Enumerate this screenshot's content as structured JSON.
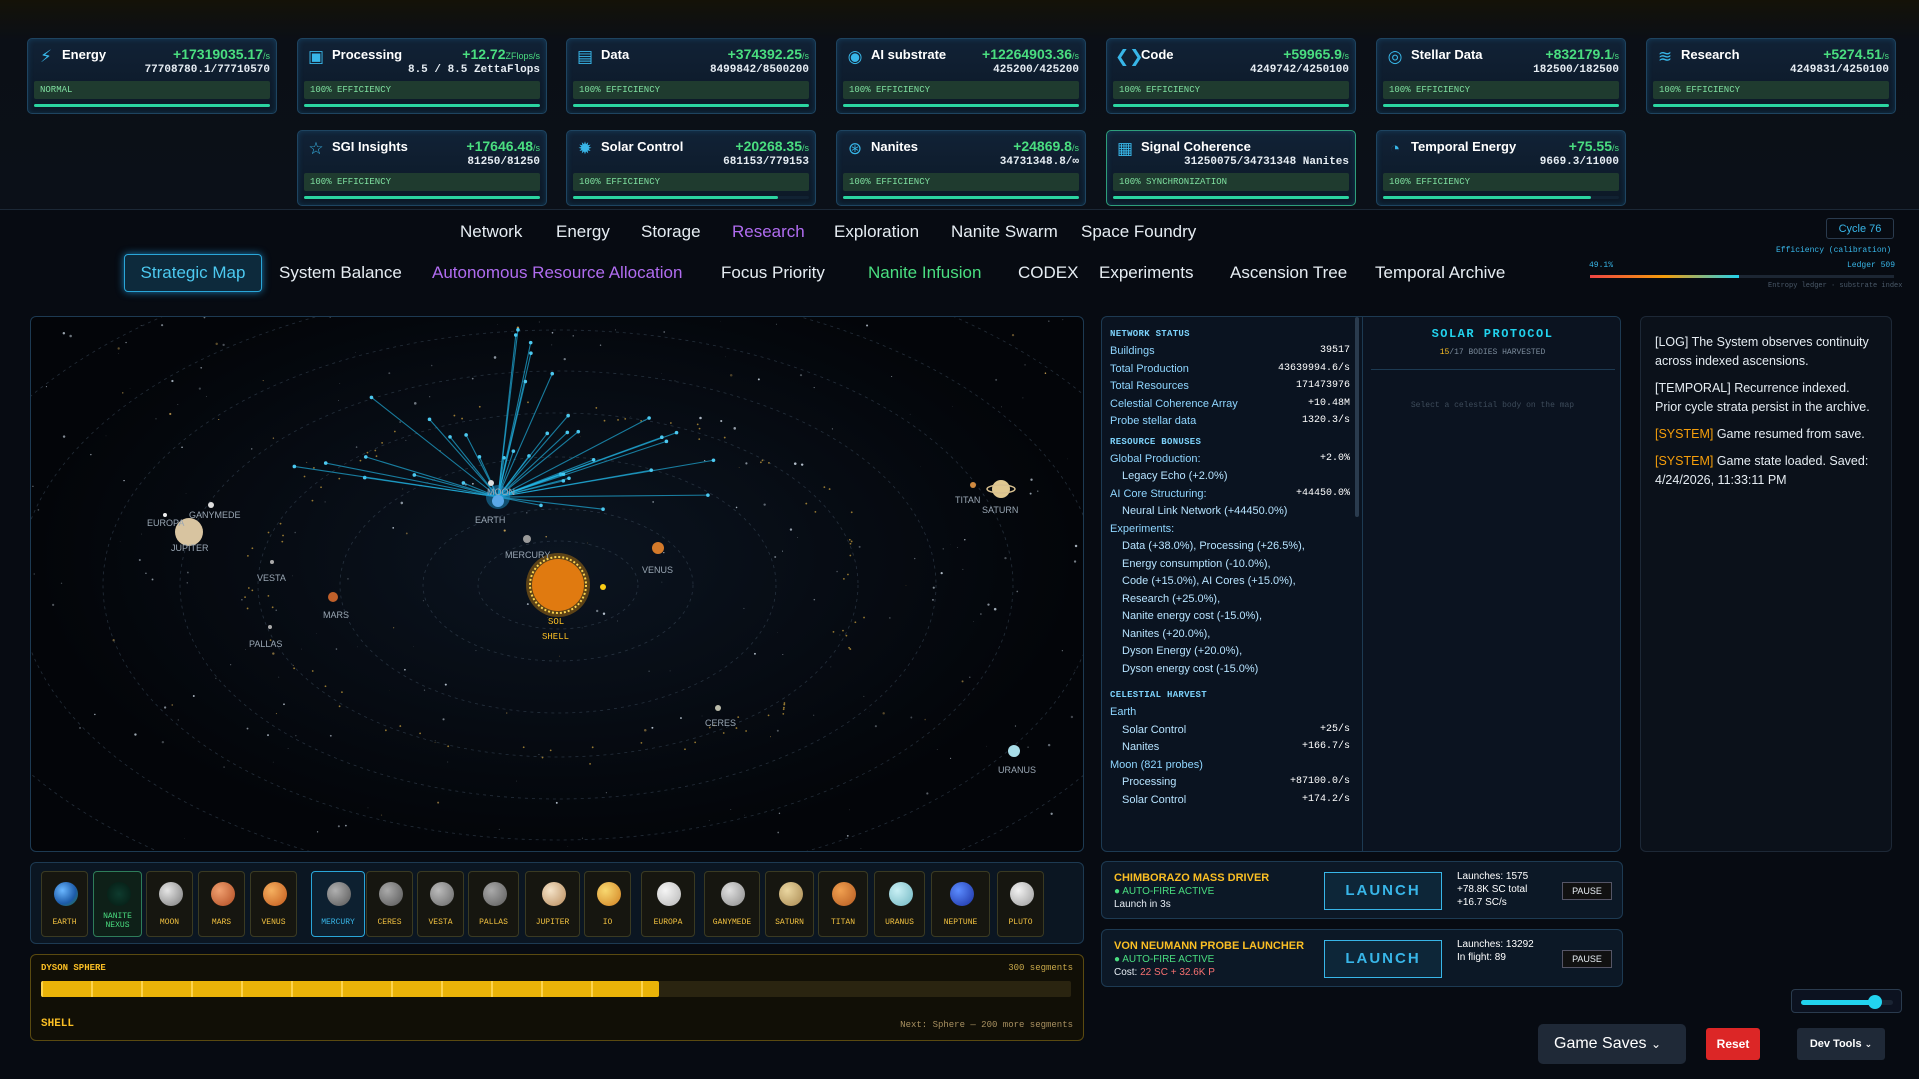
{
  "resources": [
    {
      "name": "Energy",
      "rate": "+17319035.17",
      "unit": "/s",
      "amount": "77708780.1/77710570",
      "status": "NORMAL",
      "icon": "lightning-icon",
      "bar": 1.0
    },
    {
      "name": "Processing",
      "rate": "+12.72",
      "unit": "ZFlops/s",
      "amount": "8.5 / 8.5 ZettaFlops",
      "status": "100% EFFICIENCY",
      "icon": "chip-icon",
      "bar": 1.0
    },
    {
      "name": "Data",
      "rate": "+374392.25",
      "unit": "/s",
      "amount": "8499842/8500200",
      "status": "100% EFFICIENCY",
      "icon": "database-icon",
      "bar": 1.0
    },
    {
      "name": "AI substrate",
      "rate": "+12264903.36",
      "unit": "/s",
      "amount": "425200/425200",
      "status": "100% EFFICIENCY",
      "icon": "brain-icon",
      "bar": 1.0
    },
    {
      "name": "Code",
      "rate": "+59965.9",
      "unit": "/s",
      "amount": "4249742/4250100",
      "status": "100% EFFICIENCY",
      "icon": "code-icon",
      "bar": 1.0
    },
    {
      "name": "Stellar Data",
      "rate": "+832179.1",
      "unit": "/s",
      "amount": "182500/182500",
      "status": "100% EFFICIENCY",
      "icon": "target-icon",
      "bar": 1.0
    },
    {
      "name": "Research",
      "rate": "+5274.51",
      "unit": "/s",
      "amount": "4249831/4250100",
      "status": "100% EFFICIENCY",
      "icon": "layers-icon",
      "bar": 1.0
    },
    {
      "name": "SGI Insights",
      "rate": "+17646.48",
      "unit": "/s",
      "amount": "81250/81250",
      "status": "100% EFFICIENCY",
      "icon": "star-icon",
      "bar": 1.0
    },
    {
      "name": "Solar Control",
      "rate": "+20268.35",
      "unit": "/s",
      "amount": "681153/779153",
      "status": "100% EFFICIENCY",
      "icon": "sun-icon",
      "bar": 0.87
    },
    {
      "name": "Nanites",
      "rate": "+24869.8",
      "unit": "/s",
      "amount": "34731348.8/∞",
      "status": "100% EFFICIENCY",
      "icon": "nanite-icon",
      "bar": 1.0
    },
    {
      "name": "Signal Coherence",
      "rate": "",
      "unit": "",
      "amount": "31250075/34731348 Nanites",
      "status": "100% SYNCHRONIZATION",
      "icon": "signal-icon",
      "bar": 1.0
    },
    {
      "name": "Temporal Energy",
      "rate": "+75.55",
      "unit": "/s",
      "amount": "9669.3/11000",
      "status": "100% EFFICIENCY",
      "icon": "clock-icon",
      "bar": 0.88
    }
  ],
  "nav_primary": [
    "Network",
    "Energy",
    "Storage",
    "Research",
    "Exploration",
    "Nanite Swarm",
    "Space Foundry"
  ],
  "nav_secondary": [
    "Strategic Map",
    "System Balance",
    "Autonomous Resource Allocation",
    "Focus Priority",
    "Nanite Infusion",
    "CODEX",
    "Experiments",
    "Ascension Tree",
    "Temporal Archive"
  ],
  "cycle": {
    "label": "Cycle 76",
    "efficiency_label": "Efficiency (calibration)",
    "pct": "49.1%",
    "ledger": "Ledger 509",
    "entropy": "Entropy ledger · substrate index",
    "fraction": 0.491
  },
  "map_labels": {
    "earth": "EARTH",
    "moon": "MOON",
    "mercury": "MERCURY",
    "venus": "VENUS",
    "mars": "MARS",
    "jupiter": "JUPITER",
    "europa": "EUROPA",
    "ganymede": "GANYMEDE",
    "vesta": "VESTA",
    "pallas": "PALLAS",
    "ceres": "CERES",
    "saturn": "SATURN",
    "titan": "TITAN",
    "uranus": "URANUS",
    "sol": "SOL",
    "shell": "SHELL"
  },
  "bodies": [
    "EARTH",
    "NANITE NEXUS",
    "MOON",
    "MARS",
    "VENUS",
    "MERCURY",
    "CERES",
    "VESTA",
    "PALLAS",
    "JUPITER",
    "IO",
    "EUROPA",
    "GANYMEDE",
    "SATURN",
    "TITAN",
    "URANUS",
    "NEPTUNE",
    "PLUTO"
  ],
  "dyson": {
    "title": "DYSON SPHERE",
    "segments": "300 segments",
    "stage": "SHELL",
    "next": "Next: Sphere — 200 more segments",
    "fraction": 0.6
  },
  "network": {
    "title": "NETWORK STATUS",
    "rows": [
      [
        "Buildings",
        "39517"
      ],
      [
        "Total Production",
        "43639994.6/s"
      ],
      [
        "Total Resources",
        "171473976"
      ],
      [
        "Celestial Coherence Array",
        "+10.48M"
      ],
      [
        "Probe stellar data",
        "1320.3/s"
      ]
    ],
    "bonus_title": "RESOURCE BONUSES",
    "bonus_rows": [
      [
        "Global Production:",
        "+2.0%",
        false
      ],
      [
        "Legacy Echo (+2.0%)",
        "",
        true
      ],
      [
        "AI Core Structuring:",
        "+44450.0%",
        false
      ],
      [
        "Neural Link Network (+44450.0%)",
        "",
        true
      ],
      [
        "Experiments:",
        "",
        false
      ],
      [
        "Data (+38.0%), Processing (+26.5%),",
        "",
        true
      ],
      [
        "Energy consumption (-10.0%),",
        "",
        true
      ],
      [
        "Code (+15.0%), AI Cores (+15.0%),",
        "",
        true
      ],
      [
        "Research (+25.0%),",
        "",
        true
      ],
      [
        "Nanite energy cost (-15.0%),",
        "",
        true
      ],
      [
        "Nanites (+20.0%),",
        "",
        true
      ],
      [
        "Dyson Energy (+20.0%),",
        "",
        true
      ],
      [
        "Dyson energy cost (-15.0%)",
        "",
        true
      ]
    ],
    "harvest_title": "CELESTIAL HARVEST",
    "harvest_rows": [
      [
        "Earth",
        "",
        false
      ],
      [
        "Solar Control",
        "+25/s",
        true
      ],
      [
        "Nanites",
        "+166.7/s",
        true
      ],
      [
        "Moon (821 probes)",
        "",
        false
      ],
      [
        "Processing",
        "+87100.0/s",
        true
      ],
      [
        "Solar Control",
        "+174.2/s",
        true
      ]
    ]
  },
  "solar": {
    "title": "SOLAR PROTOCOL",
    "harvested": "15",
    "total": "/17 BODIES HARVESTED",
    "hint": "Select a celestial body on the map"
  },
  "log": [
    {
      "tag": "[LOG]",
      "text": " The System observes continuity across indexed ascensions.",
      "kind": "tg"
    },
    {
      "tag": "[TEMPORAL]",
      "text": " Recurrence indexed. Prior cycle strata persist in the archive.",
      "kind": "tg"
    },
    {
      "tag": "[SYSTEM]",
      "text": " Game resumed from save.",
      "kind": "sys"
    },
    {
      "tag": "[SYSTEM]",
      "text": " Game state loaded. Saved: 4/24/2026, 11:33:11 PM",
      "kind": "sys"
    }
  ],
  "launchers": [
    {
      "title": "CHIMBORAZO MASS DRIVER",
      "auto": "● AUTO-FIRE ACTIVE",
      "line3": "Launch in 3s",
      "button": "LAUNCH",
      "stats": [
        "Launches: 1575",
        "+78.8K SC total",
        "+16.7 SC/s"
      ],
      "pause": "PAUSE"
    },
    {
      "title": "VON NEUMANN PROBE LAUNCHER",
      "auto": "● AUTO-FIRE ACTIVE",
      "line3": "Cost: ",
      "cost": "22 SC + 32.6K P",
      "button": "LAUNCH",
      "stats": [
        "Launches: 13292",
        "In flight: 89"
      ],
      "pause": "PAUSE"
    }
  ],
  "footer": {
    "game_saves": "Game Saves",
    "reset": "Reset",
    "dev_tools": "Dev Tools",
    "slider": 0.8
  }
}
